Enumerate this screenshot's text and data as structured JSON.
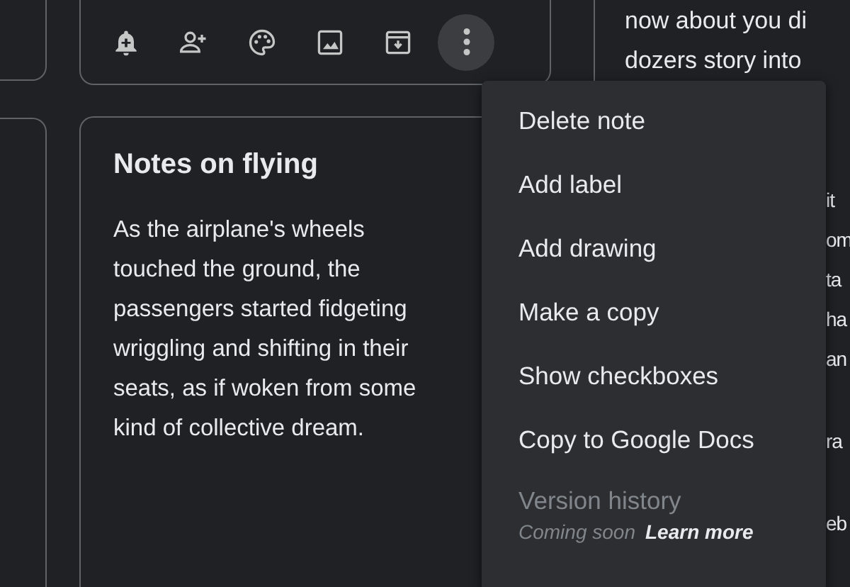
{
  "toolbar": {
    "buttons": [
      {
        "kind": "bell",
        "selected": false
      },
      {
        "kind": "person-add",
        "selected": false
      },
      {
        "kind": "palette",
        "selected": false
      },
      {
        "kind": "image",
        "selected": false
      },
      {
        "kind": "archive",
        "selected": false
      },
      {
        "kind": "more",
        "selected": true
      }
    ]
  },
  "note": {
    "title": "Notes on flying",
    "lines": [
      "As the airplane's wheels",
      "touched the ground, the",
      "passengers started fidgeting",
      "wriggling and shifting in their",
      "seats, as if woken from some",
      "kind of collective dream."
    ]
  },
  "right_note": {
    "top_lines": [
      "now about you di",
      "dozers story into"
    ],
    "edge_fragments": [
      "it",
      "om",
      "ta",
      "ha",
      "an",
      "ra",
      "eb"
    ]
  },
  "menu": {
    "items": [
      {
        "label": "Delete note",
        "disabled": false
      },
      {
        "label": "Add label",
        "disabled": false
      },
      {
        "label": "Add drawing",
        "disabled": false
      },
      {
        "label": "Make a copy",
        "disabled": false
      },
      {
        "label": "Show checkboxes",
        "disabled": false
      },
      {
        "label": "Copy to Google Docs",
        "disabled": false
      },
      {
        "label": "Version history",
        "disabled": true,
        "note": "Coming soon",
        "link": "Learn more"
      }
    ]
  }
}
